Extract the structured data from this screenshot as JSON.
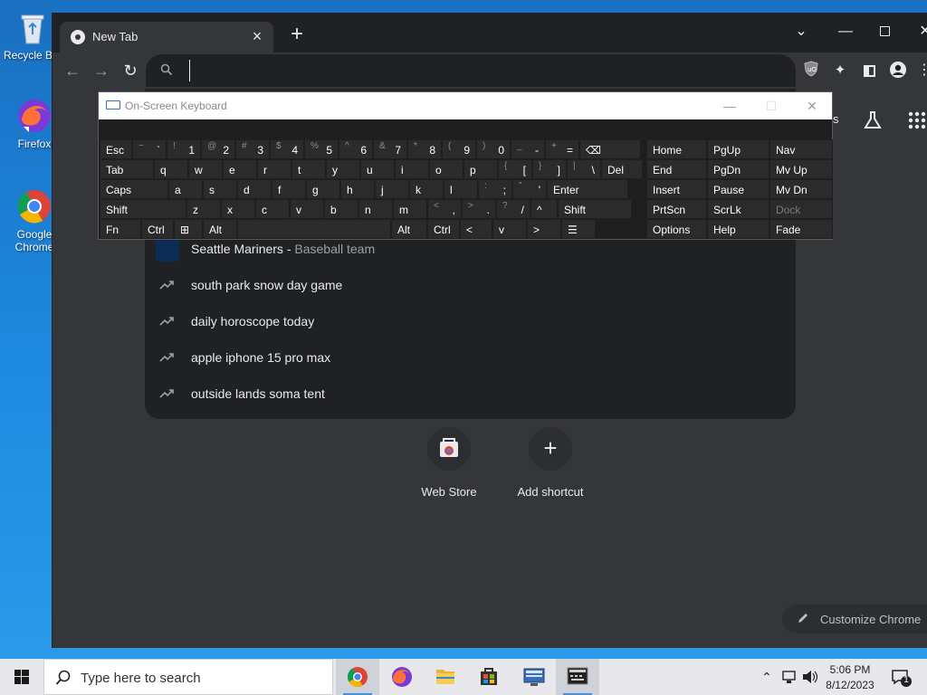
{
  "desktop": {
    "icons": [
      {
        "label": "Recycle Bin",
        "name": "recycle-bin"
      },
      {
        "label": "Firefox",
        "name": "firefox"
      },
      {
        "label": "Google Chrome",
        "name": "google-chrome"
      }
    ]
  },
  "browser": {
    "tab": {
      "title": "New Tab"
    },
    "omnibox": {
      "value": ""
    },
    "suggestions": [
      {
        "text": "Seattle Mariners",
        "sub": "Baseball team",
        "icon": "team-thumbnail"
      },
      {
        "text": "south park snow day game",
        "icon": "trending-icon"
      },
      {
        "text": "daily horoscope today",
        "icon": "trending-icon"
      },
      {
        "text": "apple iphone 15 pro max",
        "icon": "trending-icon"
      },
      {
        "text": "outside lands soma tent",
        "icon": "trending-icon"
      }
    ],
    "shortcuts": [
      {
        "label": "Web Store"
      },
      {
        "label": "Add shortcut"
      }
    ],
    "customize_label": "Customize Chrome",
    "right_edge_text": "s"
  },
  "osk": {
    "title": "On-Screen Keyboard",
    "rows": [
      [
        {
          "main": "Esc",
          "w": 1
        },
        {
          "shift": "~",
          "base": "`"
        },
        {
          "shift": "!",
          "base": "1"
        },
        {
          "shift": "@",
          "base": "2"
        },
        {
          "shift": "#",
          "base": "3"
        },
        {
          "shift": "$",
          "base": "4"
        },
        {
          "shift": "%",
          "base": "5"
        },
        {
          "shift": "^",
          "base": "6"
        },
        {
          "shift": "&",
          "base": "7"
        },
        {
          "shift": "*",
          "base": "8"
        },
        {
          "shift": "(",
          "base": "9"
        },
        {
          "shift": ")",
          "base": "0"
        },
        {
          "shift": "_",
          "base": "-"
        },
        {
          "shift": "+",
          "base": "="
        },
        {
          "main": "⌫"
        }
      ],
      [
        {
          "main": "Tab"
        },
        {
          "main": "q"
        },
        {
          "main": "w"
        },
        {
          "main": "e"
        },
        {
          "main": "r"
        },
        {
          "main": "t"
        },
        {
          "main": "y"
        },
        {
          "main": "u"
        },
        {
          "main": "i"
        },
        {
          "main": "o"
        },
        {
          "main": "p"
        },
        {
          "shift": "{",
          "base": "["
        },
        {
          "shift": "}",
          "base": "]"
        },
        {
          "shift": "|",
          "base": "\\"
        },
        {
          "main": "Del"
        }
      ],
      [
        {
          "main": "Caps"
        },
        {
          "main": "a"
        },
        {
          "main": "s"
        },
        {
          "main": "d"
        },
        {
          "main": "f"
        },
        {
          "main": "g"
        },
        {
          "main": "h"
        },
        {
          "main": "j"
        },
        {
          "main": "k"
        },
        {
          "main": "l"
        },
        {
          "shift": ":",
          "base": ";"
        },
        {
          "shift": "\"",
          "base": "'"
        },
        {
          "main": "Enter"
        }
      ],
      [
        {
          "main": "Shift"
        },
        {
          "main": "z"
        },
        {
          "main": "x"
        },
        {
          "main": "c"
        },
        {
          "main": "v"
        },
        {
          "main": "b"
        },
        {
          "main": "n"
        },
        {
          "main": "m"
        },
        {
          "shift": "<",
          "base": ","
        },
        {
          "shift": ">",
          "base": "."
        },
        {
          "shift": "?",
          "base": "/"
        },
        {
          "main": "^"
        },
        {
          "main": "Shift"
        }
      ],
      [
        {
          "main": "Fn"
        },
        {
          "main": "Ctrl"
        },
        {
          "main": "⊞"
        },
        {
          "main": "Alt"
        },
        {
          "main": ""
        },
        {
          "main": "Alt"
        },
        {
          "main": "Ctrl"
        },
        {
          "main": "<"
        },
        {
          "main": "v"
        },
        {
          "main": ">"
        },
        {
          "main": "☰"
        }
      ]
    ],
    "nav_keys": [
      [
        "Home",
        "PgUp",
        "Nav"
      ],
      [
        "End",
        "PgDn",
        "Mv Up"
      ],
      [
        "Insert",
        "Pause",
        "Mv Dn"
      ],
      [
        "PrtScn",
        "ScrLk",
        "Dock"
      ],
      [
        "Options",
        "Help",
        "Fade"
      ]
    ]
  },
  "taskbar": {
    "search_placeholder": "Type here to search",
    "clock_time": "5:06 PM",
    "clock_date": "8/12/2023",
    "notification_count": "1"
  }
}
